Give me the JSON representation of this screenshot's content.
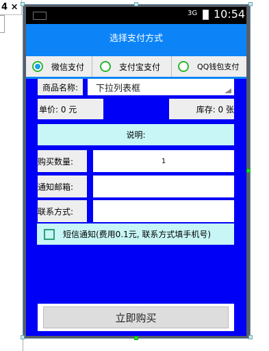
{
  "editor": {
    "tab_label": "4 ×"
  },
  "status_bar": {
    "signal": "3G",
    "time": "10:54"
  },
  "header": {
    "title": "选择支付方式"
  },
  "payment_options": [
    {
      "label": "微信支付",
      "checked": true
    },
    {
      "label": "支付宝支付",
      "checked": false
    },
    {
      "label": "QQ钱包支付",
      "checked": false
    }
  ],
  "product": {
    "name_label": "商品名称:",
    "spinner_value": "下拉列表框",
    "price_label": "单价: 0 元",
    "stock_label": "库存: 0 张",
    "description_label": "说明:"
  },
  "form": {
    "quantity_label": "购买数量:",
    "quantity_value": "1",
    "email_label": "通知邮箱:",
    "email_value": "",
    "contact_label": "联系方式:",
    "contact_value": ""
  },
  "sms": {
    "label": "短信通知(费用0.1元, 联系方式填手机号)",
    "checked": false
  },
  "action": {
    "buy_label": "立即购买"
  },
  "colors": {
    "title_bar": "#0c84f8",
    "background": "#0000f7",
    "radio_green": "#2bb52b",
    "radio_dot": "#1a9ee8",
    "cyan": "#c8f6f6"
  }
}
